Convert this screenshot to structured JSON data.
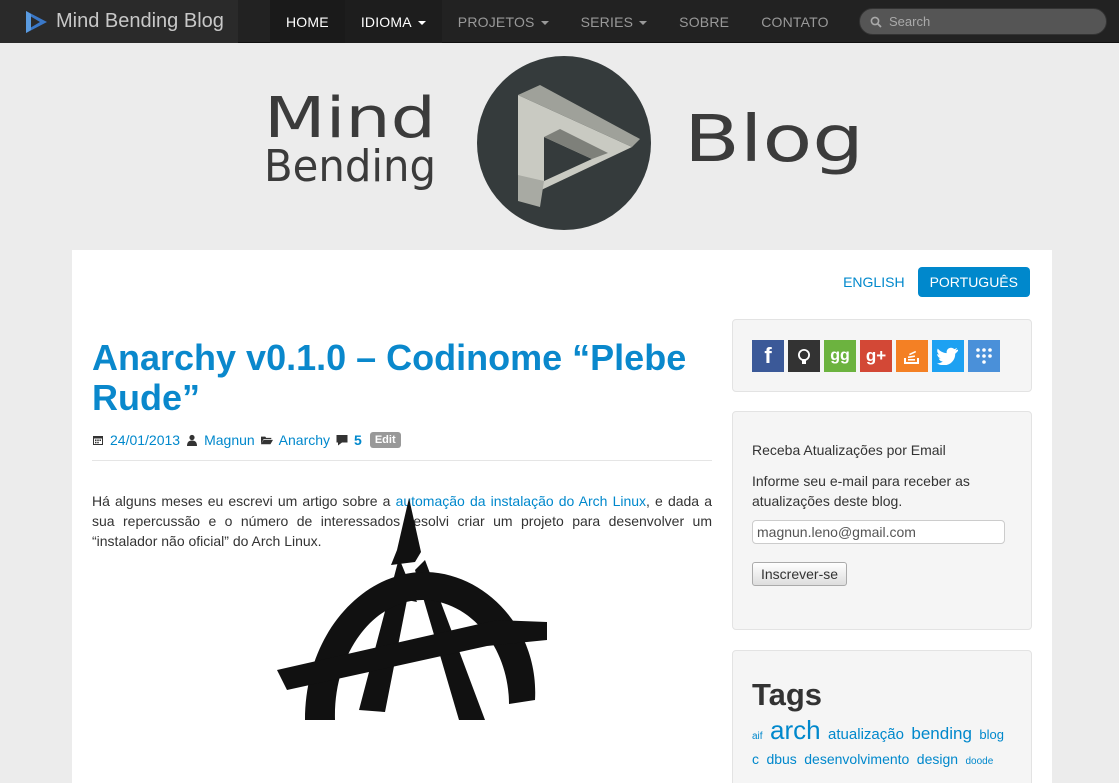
{
  "navbar": {
    "brand": "Mind Bending Blog",
    "items": [
      {
        "label": "HOME"
      },
      {
        "label": "IDIOMA"
      },
      {
        "label": "PROJETOS"
      },
      {
        "label": "SERIES"
      },
      {
        "label": "SOBRE"
      },
      {
        "label": "CONTATO"
      }
    ],
    "search_placeholder": "Search"
  },
  "header_logo": {
    "word1": "Mind",
    "word2": "Bending",
    "word3": "Blog"
  },
  "language": {
    "english": "ENGLISH",
    "portuguese": "PORTUGUÊS"
  },
  "post": {
    "title": "Anarchy v0.1.0 – Codinome “Plebe Rude”",
    "date": "24/01/2013",
    "author": "Magnun",
    "category": "Anarchy",
    "comments": "5",
    "edit": "Edit",
    "body_before": "Há alguns meses eu escrevi um artigo sobre a ",
    "body_link": "automação da instalação do Arch Linux",
    "body_after": ", e dada a sua repercussão e o número de interessados resolvi criar um projeto para desenvolver um “instalador não oficial” do Arch Linux."
  },
  "social_icons": [
    "facebook-icon",
    "github-icon",
    "goodreads-icon",
    "google-plus-icon",
    "stackoverflow-icon",
    "twitter-icon",
    "more-icon"
  ],
  "newsletter": {
    "title": "Receba Atualizações por Email",
    "description": "Informe seu e-mail para receber as atualizações deste blog.",
    "email_value": "magnun.leno@gmail.com",
    "button": "Inscrever-se"
  },
  "tags": {
    "title": "Tags",
    "items": [
      "aif",
      "arch",
      "atualização",
      "bending",
      "blog",
      "c",
      "dbus",
      "desenvolvimento",
      "design",
      "doode"
    ]
  },
  "colors": {
    "accent": "#0088cc",
    "navbar": "#222222",
    "background": "#ececec"
  }
}
